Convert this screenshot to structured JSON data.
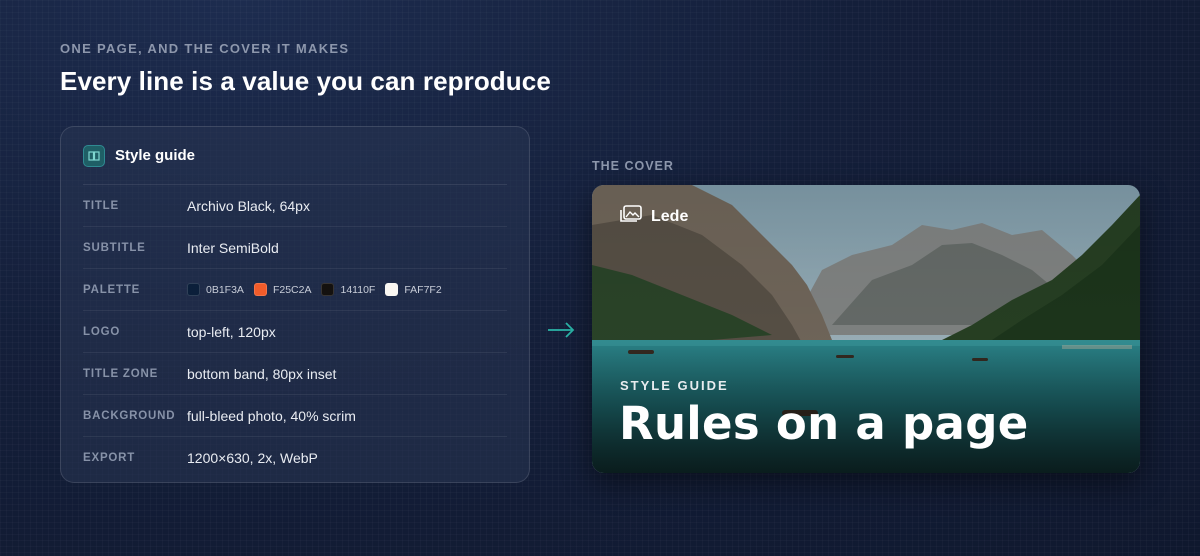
{
  "header": {
    "eyebrow": "ONE PAGE, AND THE COVER IT MAKES",
    "headline": "Every line is a value you can reproduce"
  },
  "style_guide": {
    "title": "Style guide",
    "icon": "book-icon",
    "rows": [
      {
        "label": "TITLE",
        "value": "Archivo Black, 64px"
      },
      {
        "label": "SUBTITLE",
        "value": "Inter SemiBold"
      },
      {
        "label": "PALETTE",
        "value": ""
      },
      {
        "label": "LOGO",
        "value": "top-left, 120px"
      },
      {
        "label": "TITLE ZONE",
        "value": "bottom band, 80px inset"
      },
      {
        "label": "BACKGROUND",
        "value": "full-bleed photo, 40% scrim"
      },
      {
        "label": "EXPORT",
        "value": "1200×630, 2x, WebP"
      }
    ],
    "palette": [
      {
        "code": "0B1F3A",
        "color": "#0B1F3A"
      },
      {
        "code": "F25C2A",
        "color": "#F25C2A"
      },
      {
        "code": "14110F",
        "color": "#14110F"
      },
      {
        "code": "FAF7F2",
        "color": "#FAF7F2"
      }
    ]
  },
  "arrow_icon": "arrow-right-icon",
  "cover": {
    "section_label": "THE COVER",
    "logo_icon": "image-stack-icon",
    "logo_text": "Lede",
    "eyebrow": "STYLE GUIDE",
    "title": "Rules on a page"
  },
  "colors": {
    "accent_teal": "#2BB5A8",
    "background": "#141F3A"
  }
}
